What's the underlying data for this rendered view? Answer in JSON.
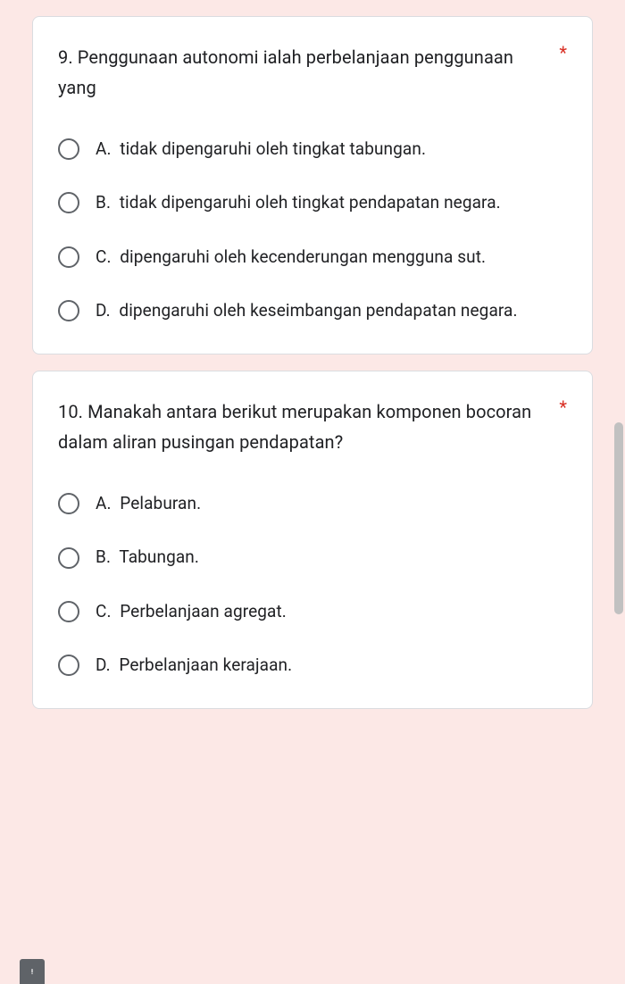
{
  "questions": [
    {
      "number": "9.",
      "text": "Penggunaan autonomi ialah perbelanjaan penggunaan yang",
      "required": true,
      "options": [
        {
          "letter": "A.",
          "text": "tidak dipengaruhi oleh tingkat tabungan."
        },
        {
          "letter": "B.",
          "text": "tidak dipengaruhi oleh tingkat pendapatan negara."
        },
        {
          "letter": "C.",
          "text": "dipengaruhi oleh kecenderungan mengguna sut."
        },
        {
          "letter": "D.",
          "text": "dipengaruhi oleh keseimbangan pendapatan negara."
        }
      ]
    },
    {
      "number": "10.",
      "text": "Manakah antara berikut merupakan komponen bocoran dalam aliran pusingan pendapatan?",
      "required": true,
      "options": [
        {
          "letter": "A.",
          "text": "Pelaburan."
        },
        {
          "letter": "B.",
          "text": "Tabungan."
        },
        {
          "letter": "C.",
          "text": "Perbelanjaan agregat."
        },
        {
          "letter": "D.",
          "text": "Perbelanjaan kerajaan."
        }
      ]
    }
  ],
  "asterisk": "*"
}
